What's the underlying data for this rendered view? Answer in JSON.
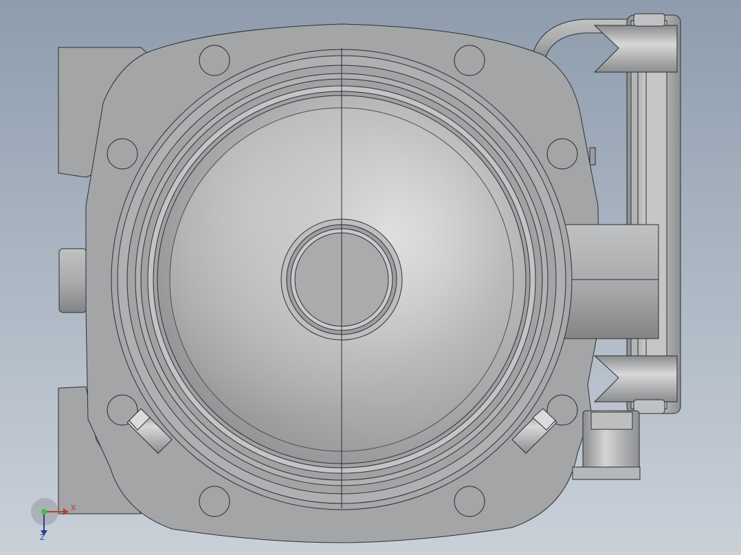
{
  "viewport": {
    "background_top": "#8e9cad",
    "background_bottom": "#c9d0d8"
  },
  "model": {
    "body_color": "#a3a5a7",
    "edge_color": "#2b2d30",
    "shade_light": "#e6e8e9",
    "shade_dark": "#7f8183"
  },
  "triad": {
    "x_label": "X",
    "z_label": "Z",
    "x_color": "#c0392b",
    "y_color": "#2ecc40",
    "z_color": "#2c3e90"
  }
}
